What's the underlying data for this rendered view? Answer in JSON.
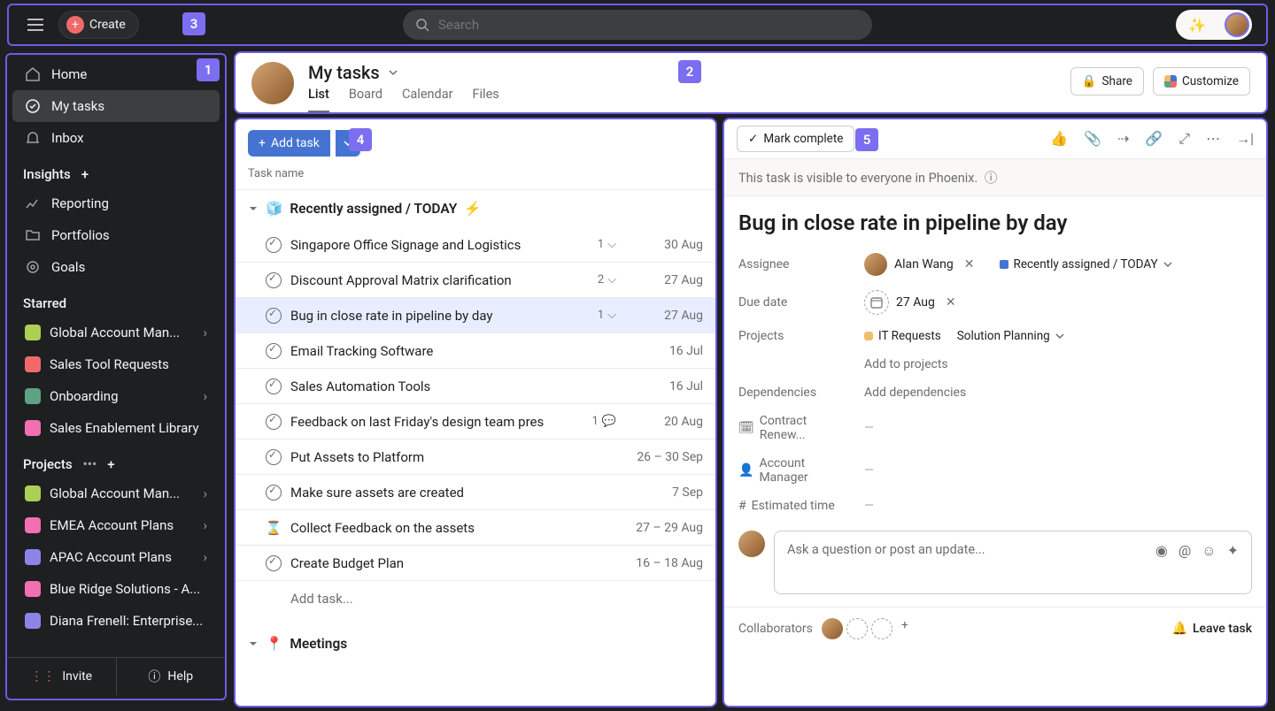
{
  "topbar": {
    "create_label": "Create",
    "search_placeholder": "Search"
  },
  "badges": {
    "b1": "1",
    "b2": "2",
    "b3": "3",
    "b4": "4",
    "b5": "5"
  },
  "sidebar": {
    "home": "Home",
    "my_tasks": "My tasks",
    "inbox": "Inbox",
    "insights_label": "Insights",
    "insights": {
      "reporting": "Reporting",
      "portfolios": "Portfolios",
      "goals": "Goals"
    },
    "starred_label": "Starred",
    "starred": [
      {
        "label": "Global Account Man...",
        "color": "c-green",
        "chev": true
      },
      {
        "label": "Sales Tool Requests",
        "color": "c-red",
        "chev": false
      },
      {
        "label": "Onboarding",
        "color": "c-teal",
        "chev": true
      },
      {
        "label": "Sales Enablement Library",
        "color": "c-pink",
        "chev": false
      }
    ],
    "projects_label": "Projects",
    "projects": [
      {
        "label": "Global Account Man...",
        "color": "c-lgreen",
        "chev": true
      },
      {
        "label": "EMEA Account Plans",
        "color": "c-lpink",
        "chev": true
      },
      {
        "label": "APAC Account Plans",
        "color": "c-purple",
        "chev": true
      },
      {
        "label": "Blue Ridge Solutions - A...",
        "color": "c-pink",
        "chev": false
      },
      {
        "label": "Diana Frenell: Enterprise...",
        "color": "c-purple",
        "chev": false
      }
    ],
    "invite": "Invite",
    "help": "Help"
  },
  "header": {
    "title": "My tasks",
    "tabs": [
      "List",
      "Board",
      "Calendar",
      "Files"
    ],
    "share": "Share",
    "customize": "Customize"
  },
  "tasklist": {
    "add_task": "Add task",
    "col_header": "Task name",
    "section1": {
      "emoji": "🧊",
      "title": "Recently assigned / TODAY",
      "bolt": "⚡"
    },
    "tasks": [
      {
        "name": "Singapore Office Signage and Logistics",
        "sub": "1",
        "subicon": "subtask",
        "date": "30 Aug"
      },
      {
        "name": "Discount Approval Matrix clarification",
        "sub": "2",
        "subicon": "subtask",
        "date": "27 Aug"
      },
      {
        "name": "Bug in close rate in pipeline by day",
        "sub": "1",
        "subicon": "subtask",
        "date": "27 Aug",
        "selected": true
      },
      {
        "name": "Email Tracking Software",
        "date": "16 Jul"
      },
      {
        "name": "Sales Automation Tools",
        "date": "16 Jul"
      },
      {
        "name": "Feedback on last Friday's design team pres",
        "sub": "1",
        "subicon": "comment",
        "date": "20 Aug"
      },
      {
        "name": "Put Assets to Platform",
        "date": "26 – 30 Sep"
      },
      {
        "name": "Make sure assets are created",
        "date": "7 Sep"
      },
      {
        "name": "Collect Feedback on the assets",
        "date": "27 – 29 Aug",
        "hourglass": true
      },
      {
        "name": "Create Budget Plan",
        "date": "16 – 18 Aug"
      }
    ],
    "add_inline": "Add task...",
    "section2": {
      "emoji": "📍",
      "title": "Meetings"
    }
  },
  "detail": {
    "mark_complete": "Mark complete",
    "visibility": "This task is visible to everyone in Phoenix.",
    "title": "Bug in close rate in pipeline by day",
    "assignee_label": "Assignee",
    "assignee": "Alan Wang",
    "assignee_section": "Recently assigned / TODAY",
    "due_label": "Due date",
    "due_date": "27 Aug",
    "projects_label": "Projects",
    "projects": [
      {
        "name": "IT Requests",
        "color": "#f1bd6c"
      },
      {
        "name": "Solution Planning",
        "chev": true
      }
    ],
    "add_projects": "Add to projects",
    "dep_label": "Dependencies",
    "add_deps": "Add dependencies",
    "contract_label": "Contract Renew...",
    "am_label": "Account Manager",
    "est_label": "Estimated time",
    "comment_ph": "Ask a question or post an update...",
    "collab_label": "Collaborators",
    "leave": "Leave task"
  }
}
